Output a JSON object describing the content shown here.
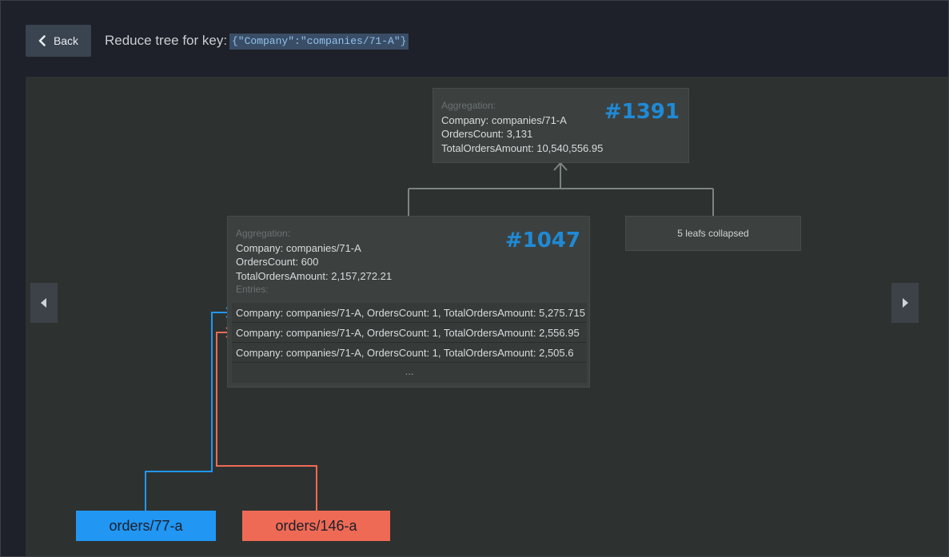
{
  "header": {
    "back_label": "Back",
    "title": "Reduce tree for key:",
    "key": "{\"Company\":\"companies/71-A\"}"
  },
  "root_node": {
    "label": "Aggregation:",
    "company": "Company: companies/71-A",
    "orders_count": "OrdersCount: 3,131",
    "total": "TotalOrdersAmount: 10,540,556.95",
    "id": "#1391"
  },
  "child_node": {
    "label": "Aggregation:",
    "company": "Company: companies/71-A",
    "orders_count": "OrdersCount: 600",
    "total": "TotalOrdersAmount: 2,157,272.21",
    "id": "#1047",
    "entries_label": "Entries:",
    "entries": [
      "Company: companies/71-A, OrdersCount: 1, TotalOrdersAmount: 5,275.715",
      "Company: companies/71-A, OrdersCount: 1, TotalOrdersAmount: 2,556.95",
      "Company: companies/71-A, OrdersCount: 1, TotalOrdersAmount: 2,505.6"
    ],
    "more": "..."
  },
  "collapsed_node": {
    "text": "5 leafs collapsed"
  },
  "documents": [
    {
      "name": "orders/77-a",
      "color": "#2196f3"
    },
    {
      "name": "orders/146-a",
      "color": "#ef6a55"
    }
  ],
  "colors": {
    "accent": "#1f8ad6",
    "connector": "#7b8483",
    "blue_link": "#2196f3",
    "red_link": "#ef6a55"
  }
}
